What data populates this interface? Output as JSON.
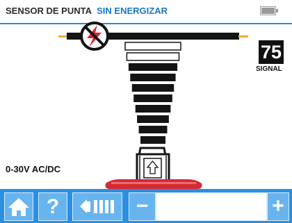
{
  "header": {
    "title": "SENSOR DE PUNTA",
    "status": "SIN ENERGIZAR"
  },
  "meter": {
    "signal_value": "75",
    "signal_label": "SIGNAL",
    "range_label": "0-30V AC/DC",
    "level_bars_total": 10,
    "level_bars_empty": 2
  },
  "toolbar": {
    "help_label": "?",
    "minus_label": "−",
    "plus_label": "+"
  },
  "colors": {
    "accent_blue": "#2a8fe0",
    "button_blue": "#67b4ef",
    "status_text": "#1a78c8",
    "warning_red": "#d9262e",
    "wire_gold": "#e7b22b",
    "base_red": "#d22b33"
  },
  "icons": {
    "no_energy": "no-power-icon",
    "home": "home-icon",
    "volume": "volume-icon",
    "battery": "battery-icon"
  }
}
